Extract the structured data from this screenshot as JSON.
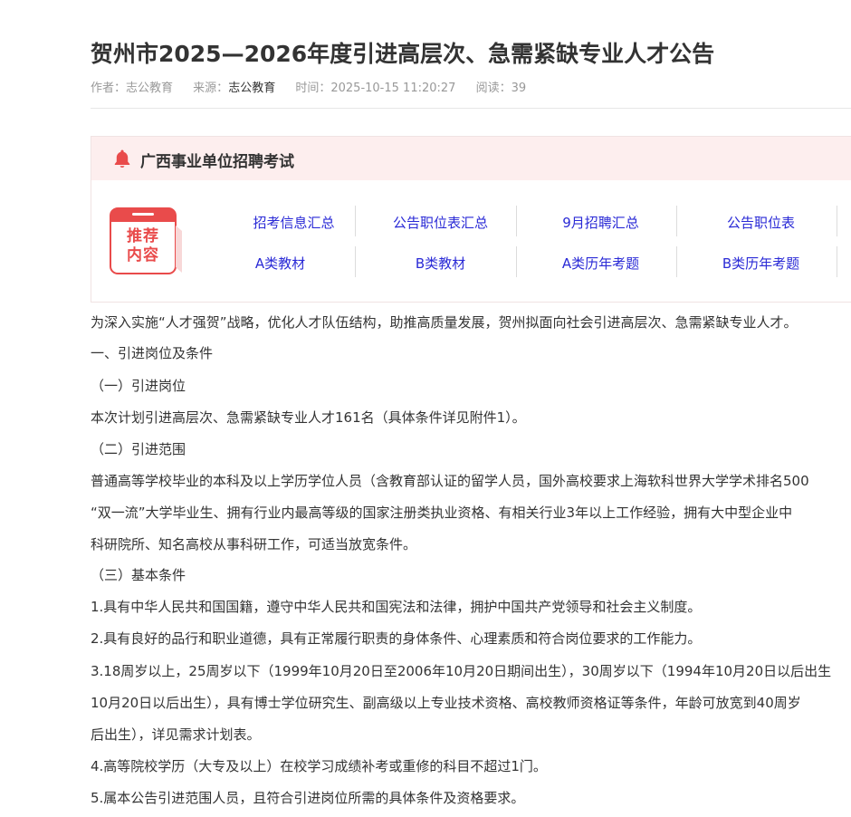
{
  "article": {
    "title": "贺州市2025—2026年度引进高层次、急需紧缺专业人才公告",
    "meta": {
      "author_label": "作者：",
      "author": "志公教育",
      "source_label": "来源：",
      "source": "志公教育",
      "time_label": "时间：",
      "time": "2025-10-15 11:20:27",
      "views_label": "阅读：",
      "views": "39"
    }
  },
  "recommend": {
    "header": "广西事业单位招聘考试",
    "badge_line1": "推荐",
    "badge_line2": "内容",
    "links_row1": [
      "招考信息汇总",
      "公告职位表汇总",
      "9月招聘汇总",
      "公告职位表"
    ],
    "links_row2": [
      "A类教材",
      "B类教材",
      "A类历年考题",
      "B类历年考题"
    ]
  },
  "colors": {
    "accent": "#e94b4b",
    "link": "#2a2ad6",
    "header_bg": "#fdeeee"
  },
  "body": [
    "为深入实施“人才强贺”战略，优化人才队伍结构，助推高质量发展，贺州拟面向社会引进高层次、急需紧缺专业人才。",
    "一、引进岗位及条件",
    "（一）引进岗位",
    "本次计划引进高层次、急需紧缺专业人才161名（具体条件详见附件1）。",
    "（二）引进范围",
    "普通高等学校毕业的本科及以上学历学位人员（含教育部认证的留学人员，国外高校要求上海软科世界大学学术排名500",
    "“双一流”大学毕业生、拥有行业内最高等级的国家注册类执业资格、有相关行业3年以上工作经验，拥有大中型企业中",
    "科研院所、知名高校从事科研工作，可适当放宽条件。",
    "（三）基本条件",
    "1.具有中华人民共和国国籍，遵守中华人民共和国宪法和法律，拥护中国共产党领导和社会主义制度。",
    "2.具有良好的品行和职业道德，具有正常履行职责的身体条件、心理素质和符合岗位要求的工作能力。",
    "3.18周岁以上，25周岁以下（1999年10月20日至2006年10月20日期间出生），30周岁以下（1994年10月20日以后出生",
    "10月20日以后出生），具有博士学位研究生、副高级以上专业技术资格、高校教师资格证等条件，年龄可放宽到40周岁",
    "后出生），详见需求计划表。",
    "4.高等院校学历（大专及以上）在校学习成绩补考或重修的科目不超过1门。",
    "5.属本公告引进范围人员，且符合引进岗位所需的具体条件及资格要求。"
  ]
}
